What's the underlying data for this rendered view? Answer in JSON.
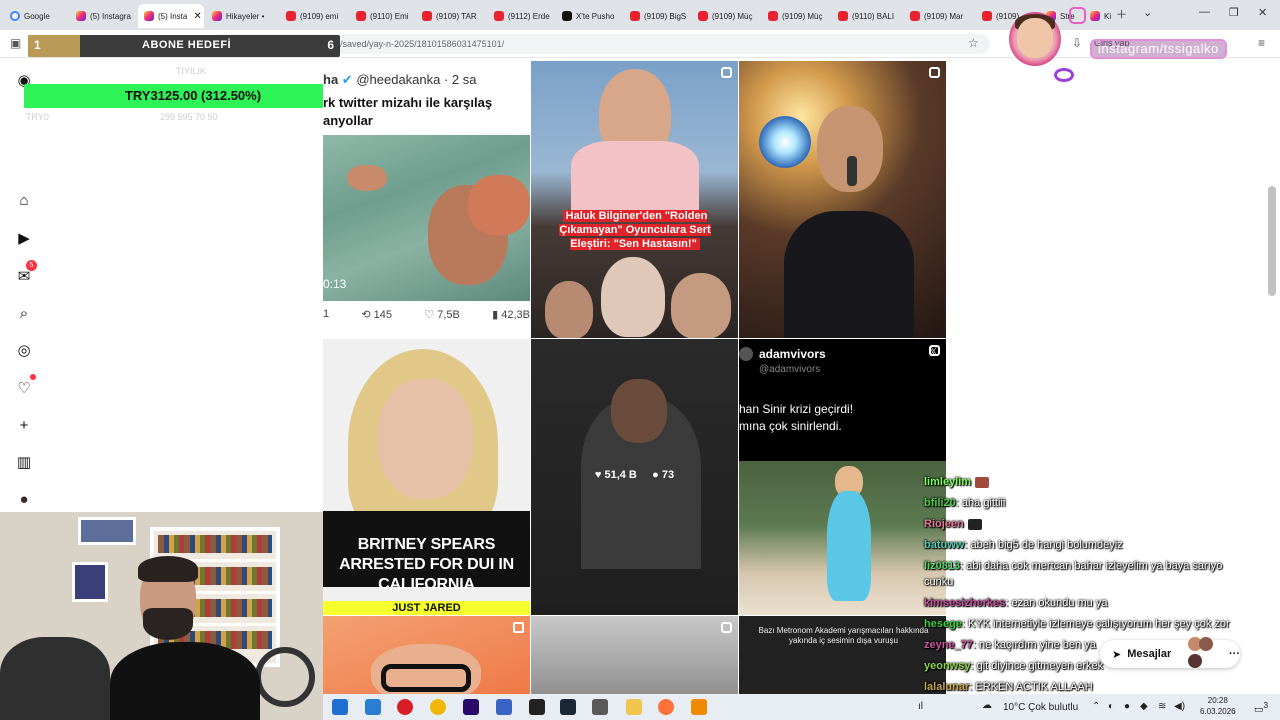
{
  "browser": {
    "tabs": [
      {
        "label": "Google",
        "icon": "google-icon"
      },
      {
        "label": "(5) Instagra",
        "icon": "instagram-icon"
      },
      {
        "label": "(5) Insta",
        "icon": "instagram-icon",
        "active": true
      },
      {
        "label": "Hikayeler •",
        "icon": "instagram-icon"
      },
      {
        "label": "(9109) emi",
        "icon": "youtube-icon"
      },
      {
        "label": "(9110) Emi",
        "icon": "youtube-icon"
      },
      {
        "label": "(9109) TAR",
        "icon": "youtube-icon"
      },
      {
        "label": "(9112) Erde",
        "icon": "youtube-icon"
      },
      {
        "label": "X'te Pusho",
        "icon": "x-icon"
      },
      {
        "label": "(9109) BigS",
        "icon": "youtube-icon"
      },
      {
        "label": "(9109) Müç",
        "icon": "youtube-icon"
      },
      {
        "label": "(9109) Müç",
        "icon": "youtube-icon"
      },
      {
        "label": "(9110) BALI",
        "icon": "youtube-icon"
      },
      {
        "label": "(9109) Mar",
        "icon": "youtube-icon"
      },
      {
        "label": "(9109)",
        "icon": "youtube-icon"
      },
      {
        "label": "Stre",
        "icon": "instagram-icon"
      },
      {
        "label": "Ki",
        "icon": "instagram-icon"
      }
    ],
    "url": "www.instagram.com/tame…/saved/yay-n-2025/18101586031475101/",
    "signin_label": "Giriş yap"
  },
  "overlays": {
    "sub_goal": {
      "left_value": "1",
      "label": "ABONE HEDEFİ",
      "right_value": "6",
      "progress": 0.1667
    },
    "donation": {
      "text": "TRY3125.00 (312.50%)",
      "progress": 1.0
    },
    "faint_labels": [
      "TRY0",
      "TIYILIK",
      "299 595 70 50"
    ]
  },
  "sidebar": {
    "items": [
      {
        "name": "home",
        "icon": "⌂"
      },
      {
        "name": "reels",
        "icon": "▶"
      },
      {
        "name": "messages",
        "icon": "✉",
        "badge": "5"
      },
      {
        "name": "search",
        "icon": "⌕"
      },
      {
        "name": "explore",
        "icon": "◎"
      },
      {
        "name": "notifications",
        "icon": "♡"
      },
      {
        "name": "create",
        "icon": "+"
      },
      {
        "name": "dashboard",
        "icon": "▥"
      },
      {
        "name": "profile",
        "icon": "●"
      }
    ]
  },
  "posts": {
    "tweet": {
      "handle": "ha",
      "user": "@heedakanka · 2 sa",
      "text": "rk twitter mizahı ile karşılaş\nanyollar",
      "video_time": "0:13",
      "reply_count": "1",
      "retweets": "145",
      "likes": "7,5B",
      "views": "42,3B"
    },
    "haluk_caption": "Haluk Bilginer'den \"Rolden Çıkamayan\" Oyunculara Sert Eleştiri: \"Sen Hastasın!\"",
    "britney": {
      "headline": "BRITNEY SPEARS ARRESTED FOR DUI IN CALIFORNIA",
      "footer": "JUST JARED"
    },
    "dark_post": {
      "likes": "51,4 B",
      "comments": "73"
    },
    "adam": {
      "name": "adamvivors",
      "handle": "@adamvivors",
      "text": "han Sinir krizi geçirdi!\nmına çok sinirlendi."
    },
    "metronom_caption": "Bazı Metronom Akademi yarışmacıları hakkında yakında iç sesimin dışa vuruşu"
  },
  "chat": [
    {
      "user": "limleylim",
      "text": "",
      "color": "#7cff56",
      "emote": "#a04b3b"
    },
    {
      "user": "bfili20",
      "text": "aha gittiii",
      "color": "#50d24a"
    },
    {
      "user": "Riojeen",
      "text": "",
      "color": "#e07b9a",
      "emote": "#222"
    },
    {
      "user": "batuww",
      "text": "abeh big5 de hangi bolumdeyiz",
      "color": "#57c9b0"
    },
    {
      "user": "liz0813",
      "text": "abi daha cok mertcan bahar izleyelim ya baya sarıyo",
      "color": "#59d86e"
    },
    {
      "user": "",
      "text": "cunku",
      "color": "#ffffff"
    },
    {
      "user": "kimsesizherkes",
      "text": "ezan okundu mu ya",
      "color": "#c34f9b"
    },
    {
      "user": "hesege",
      "text": "KYK internetiyle izlemeye çalışıyorum her şey çok zor",
      "color": "#3ecf3e"
    },
    {
      "user": "zeyne_77",
      "text": "ne kaçırdım yine ben ya",
      "color": "#c9599b"
    },
    {
      "user": "yeonwsy",
      "text": "git diyince gitmeyen erkek",
      "color": "#8bd44a"
    },
    {
      "user": "lalalunar",
      "text": "ERKEN ACTIK ALLAAH",
      "color": "#c7a64a"
    }
  ],
  "right_overlay": {
    "ig_handle": "instagram/tssigalko",
    "messages_label": "Mesajlar"
  },
  "taskbar": {
    "weather": "10°C  Çok bulutlu",
    "time": "20:28",
    "date": "6.03.2026",
    "notif_count": "3"
  }
}
